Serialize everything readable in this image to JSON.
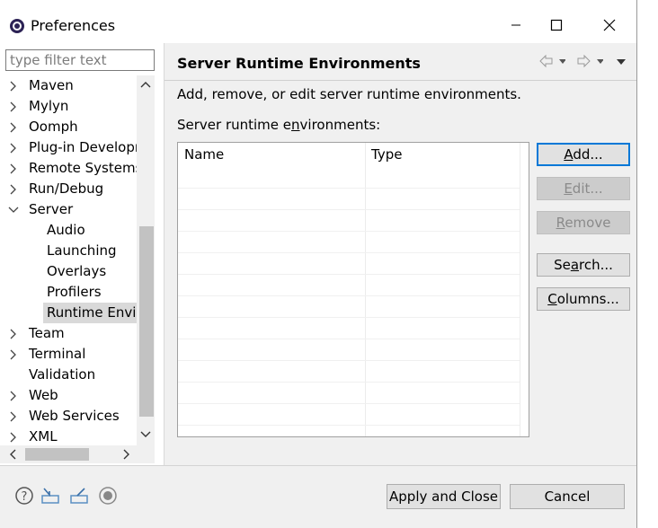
{
  "window": {
    "title": "Preferences"
  },
  "filter": {
    "placeholder": "type filter text"
  },
  "tree": [
    {
      "label": "Maven",
      "indent": 0,
      "expandable": true,
      "expanded": false,
      "selected": false
    },
    {
      "label": "Mylyn",
      "indent": 0,
      "expandable": true,
      "expanded": false,
      "selected": false
    },
    {
      "label": "Oomph",
      "indent": 0,
      "expandable": true,
      "expanded": false,
      "selected": false
    },
    {
      "label": "Plug-in Developm",
      "indent": 0,
      "expandable": true,
      "expanded": false,
      "selected": false
    },
    {
      "label": "Remote Systems",
      "indent": 0,
      "expandable": true,
      "expanded": false,
      "selected": false
    },
    {
      "label": "Run/Debug",
      "indent": 0,
      "expandable": true,
      "expanded": false,
      "selected": false
    },
    {
      "label": "Server",
      "indent": 0,
      "expandable": true,
      "expanded": true,
      "selected": false
    },
    {
      "label": "Audio",
      "indent": 1,
      "expandable": false,
      "expanded": false,
      "selected": false
    },
    {
      "label": "Launching",
      "indent": 1,
      "expandable": false,
      "expanded": false,
      "selected": false
    },
    {
      "label": "Overlays",
      "indent": 1,
      "expandable": false,
      "expanded": false,
      "selected": false
    },
    {
      "label": "Profilers",
      "indent": 1,
      "expandable": false,
      "expanded": false,
      "selected": false
    },
    {
      "label": "Runtime Envir",
      "indent": 1,
      "expandable": false,
      "expanded": false,
      "selected": true
    },
    {
      "label": "Team",
      "indent": 0,
      "expandable": true,
      "expanded": false,
      "selected": false
    },
    {
      "label": "Terminal",
      "indent": 0,
      "expandable": true,
      "expanded": false,
      "selected": false
    },
    {
      "label": "Validation",
      "indent": 0,
      "expandable": false,
      "expanded": false,
      "selected": false
    },
    {
      "label": "Web",
      "indent": 0,
      "expandable": true,
      "expanded": false,
      "selected": false
    },
    {
      "label": "Web Services",
      "indent": 0,
      "expandable": true,
      "expanded": false,
      "selected": false
    },
    {
      "label": "XML",
      "indent": 0,
      "expandable": true,
      "expanded": false,
      "selected": false
    }
  ],
  "page": {
    "title": "Server Runtime Environments",
    "description": "Add, remove, or edit server runtime environments.",
    "list_label_pre": "Server runtime e",
    "list_label_mnemonic": "n",
    "list_label_post": "vironments:",
    "columns": [
      "Name",
      "Type"
    ],
    "rows": []
  },
  "buttons": {
    "add": {
      "mn": "A",
      "rest": "dd..."
    },
    "edit": {
      "mn": "E",
      "rest": "dit..."
    },
    "remove": {
      "mn": "R",
      "rest": "emove"
    },
    "search": {
      "pre": "Se",
      "mn": "a",
      "rest": "rch..."
    },
    "columns": {
      "mn": "C",
      "rest": "olumns..."
    }
  },
  "footer": {
    "apply_close": "Apply and Close",
    "cancel": "Cancel"
  },
  "colors": {
    "default_button_border": "#0078d7",
    "selection": "#d9d9d9",
    "disabled_button": "#cccccc"
  }
}
